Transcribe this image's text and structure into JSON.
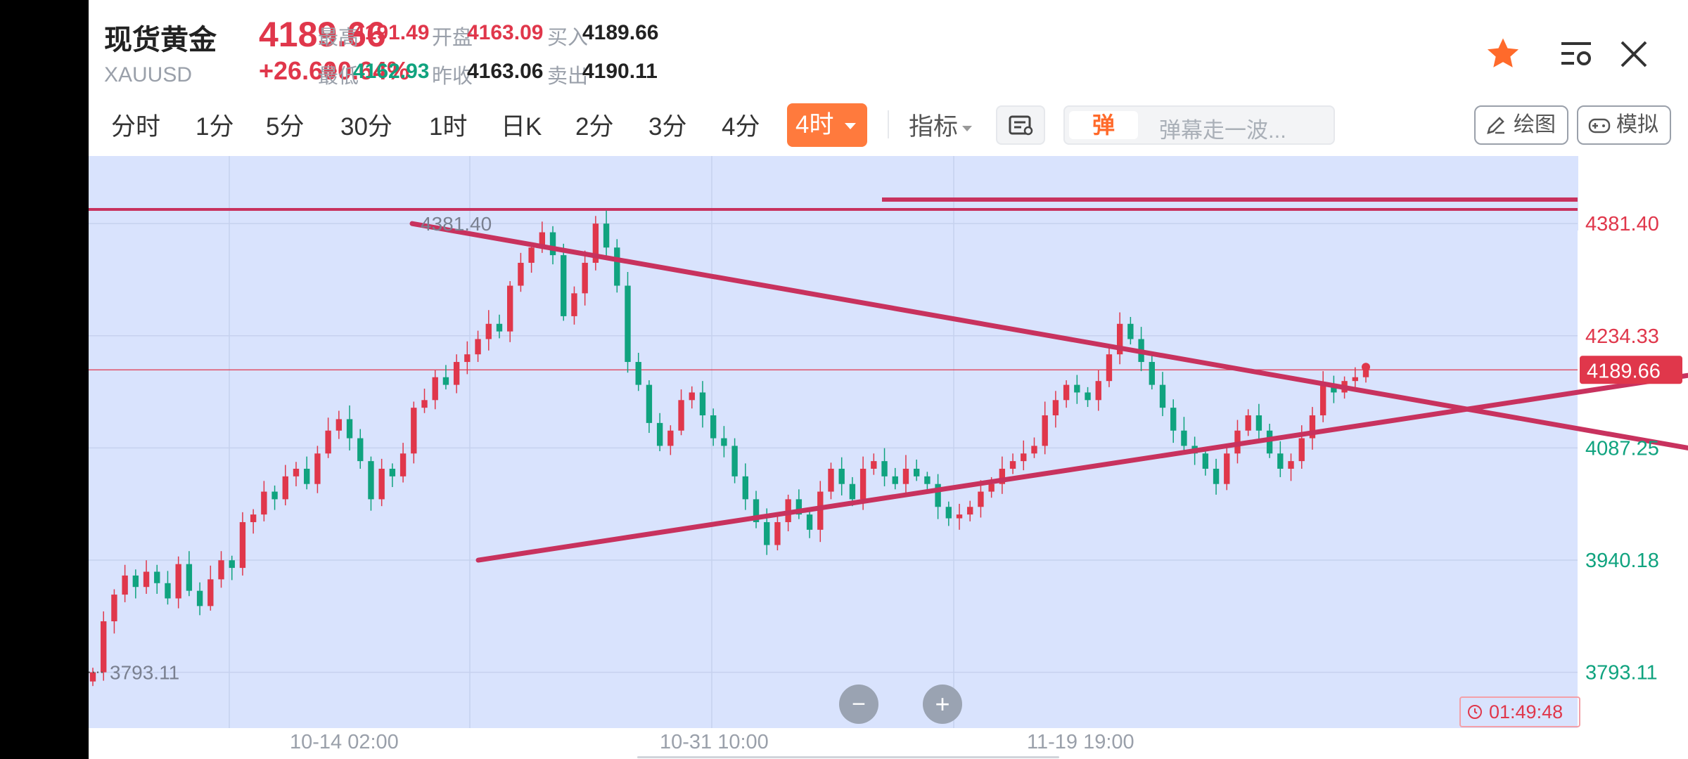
{
  "header": {
    "name": "现货黄金",
    "symbol": "XAUUSD",
    "price": "4189.66",
    "change": "+26.60",
    "change_pct": "+0.64%",
    "quotes": {
      "high_label": "最高",
      "high": "4191.49",
      "low_label": "最低",
      "low": "4162.93",
      "open_label": "开盘",
      "open": "4163.09",
      "prev_close_label": "昨收",
      "prev_close": "4163.06",
      "bid_label": "买入",
      "bid": "4189.66",
      "ask_label": "卖出",
      "ask": "4190.11"
    },
    "icons": {
      "favorite": "star-icon",
      "settings": "list-settings-icon",
      "close": "close-icon"
    },
    "colors": {
      "up": "#e0374b",
      "down": "#10a37f",
      "favorite": "#ff6a2b"
    }
  },
  "toolbar": {
    "tabs": [
      "分时",
      "1分",
      "5分",
      "30分",
      "1时",
      "日K",
      "2分",
      "3分",
      "4分"
    ],
    "active_tab": "4时",
    "indicator_label": "指标",
    "danmu_badge": "弹",
    "danmu_placeholder": "弹幕走一波...",
    "draw_label": "绘图",
    "simulate_label": "模拟"
  },
  "chart_data": {
    "type": "candlestick",
    "y_ticks": [
      "4381.40",
      "4234.33",
      "4087.25",
      "3940.18",
      "3793.11"
    ],
    "ylim": [
      3720,
      4470
    ],
    "x_ticks": [
      "10-14 02:00",
      "10-31 10:00",
      "11-19 19:00"
    ],
    "current_price_label": "4189.66",
    "high_annotation": "4381.40",
    "low_annotation": "3793.11",
    "candles_close": [
      3793.11,
      3860,
      3895,
      3920,
      3905,
      3925,
      3910,
      3890,
      3935,
      3900,
      3880,
      3915,
      3940,
      3930,
      3990,
      4000,
      4030,
      4020,
      4050,
      4060,
      4040,
      4080,
      4110,
      4125,
      4100,
      4070,
      4020,
      4060,
      4050,
      4080,
      4140,
      4150,
      4180,
      4170,
      4200,
      4210,
      4230,
      4250,
      4240,
      4300,
      4330,
      4350,
      4370,
      4340,
      4260,
      4290,
      4330,
      4381.4,
      4350,
      4300,
      4200,
      4170,
      4120,
      4090,
      4110,
      4150,
      4160,
      4130,
      4100,
      4090,
      4050,
      4020,
      3990,
      3960,
      3990,
      4020,
      4000,
      3980,
      4030,
      4060,
      4040,
      4020,
      4060,
      4070,
      4050,
      4040,
      4060,
      4050,
      4040,
      4010,
      3995,
      4000,
      4010,
      4030,
      4040,
      4060,
      4070,
      4080,
      4090,
      4130,
      4150,
      4170,
      4160,
      4150,
      4175,
      4210,
      4250,
      4230,
      4200,
      4170,
      4140,
      4110,
      4090,
      4080,
      4060,
      4040,
      4080,
      4110,
      4130,
      4110,
      4080,
      4060,
      4070,
      4100,
      4130,
      4170,
      4160,
      4175,
      4180,
      4189.66
    ],
    "trendlines": [
      {
        "name": "upper-resistance",
        "from": [
          460,
          4381.4
        ],
        "to": [
          2274,
          4087.25
        ]
      },
      {
        "name": "lower-support",
        "from": [
          554,
          3940.18
        ],
        "to": [
          2326,
          4189.66
        ]
      }
    ],
    "horizontal_line": 4400,
    "colors": {
      "up": "#e0374b",
      "down": "#10a37f",
      "trendline": "#c8325e",
      "background": "#d9e3fd"
    }
  },
  "controls": {
    "zoom_out": "−",
    "zoom_in": "+",
    "timer": "01:49:48"
  }
}
